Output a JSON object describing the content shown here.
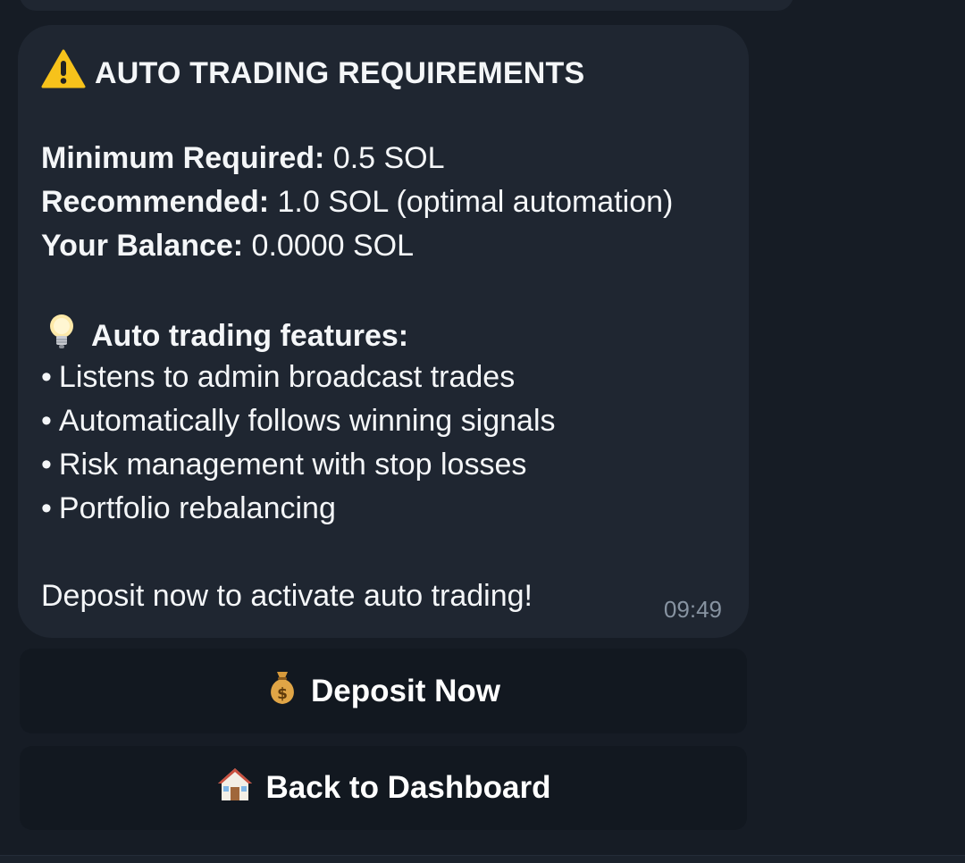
{
  "message": {
    "title_icon": "warning-icon",
    "title": "AUTO TRADING REQUIREMENTS",
    "requirements": [
      {
        "label": "Minimum Required:",
        "value": " 0.5 SOL"
      },
      {
        "label": "Recommended:",
        "value": " 1.0 SOL (optimal automation)"
      },
      {
        "label": "Your Balance:",
        "value": " 0.0000 SOL"
      }
    ],
    "features_icon": "lightbulb-icon",
    "features_heading": "Auto trading features:",
    "bullet_char": "•",
    "features": [
      "Listens to admin broadcast trades",
      "Automatically follows winning signals",
      "Risk management with stop losses",
      "Portfolio rebalancing"
    ],
    "cta_text": "Deposit now to activate auto trading!",
    "timestamp": "09:49"
  },
  "buttons": {
    "deposit": {
      "icon": "money-bag-icon",
      "label": "Deposit Now"
    },
    "back": {
      "icon": "house-icon",
      "label": "Back to Dashboard"
    }
  },
  "colors": {
    "background": "#161c25",
    "bubble": "#1f2631",
    "button": "#121820",
    "text": "#ffffff",
    "timestamp": "#8793a1"
  }
}
